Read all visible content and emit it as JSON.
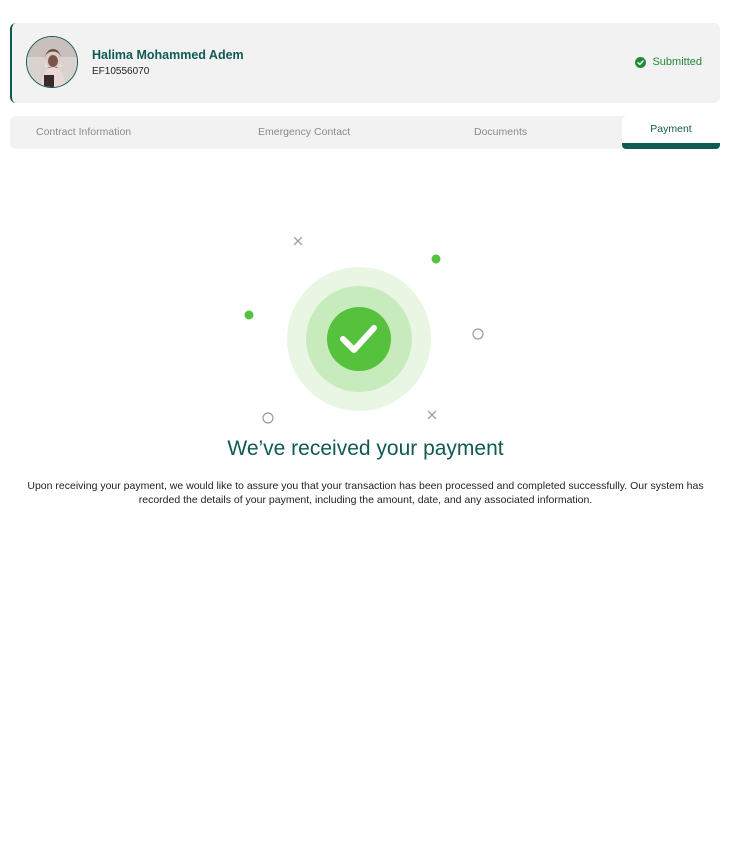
{
  "profile": {
    "name": "Halima Mohammed Adem",
    "id": "EF10556070",
    "status": "Submitted",
    "status_icon": "check-circle-icon",
    "status_color": "#1f8a3a"
  },
  "tabs": [
    {
      "label": "Contract Information",
      "active": false
    },
    {
      "label": "Emergency Contact",
      "active": false
    },
    {
      "label": "Documents",
      "active": false
    },
    {
      "label": "Payment",
      "active": true
    }
  ],
  "success": {
    "icon": "check-circle-icon",
    "title": "We’ve received your payment",
    "message": "Upon receiving your payment, we would like to assure you that your transaction has been processed and completed successfully. Our system has recorded the details of your payment, including the amount, date, and any associated information."
  },
  "colors": {
    "brand": "#0f5a52",
    "success_green": "#55c13d",
    "tab_background": "#f2f2f2"
  }
}
